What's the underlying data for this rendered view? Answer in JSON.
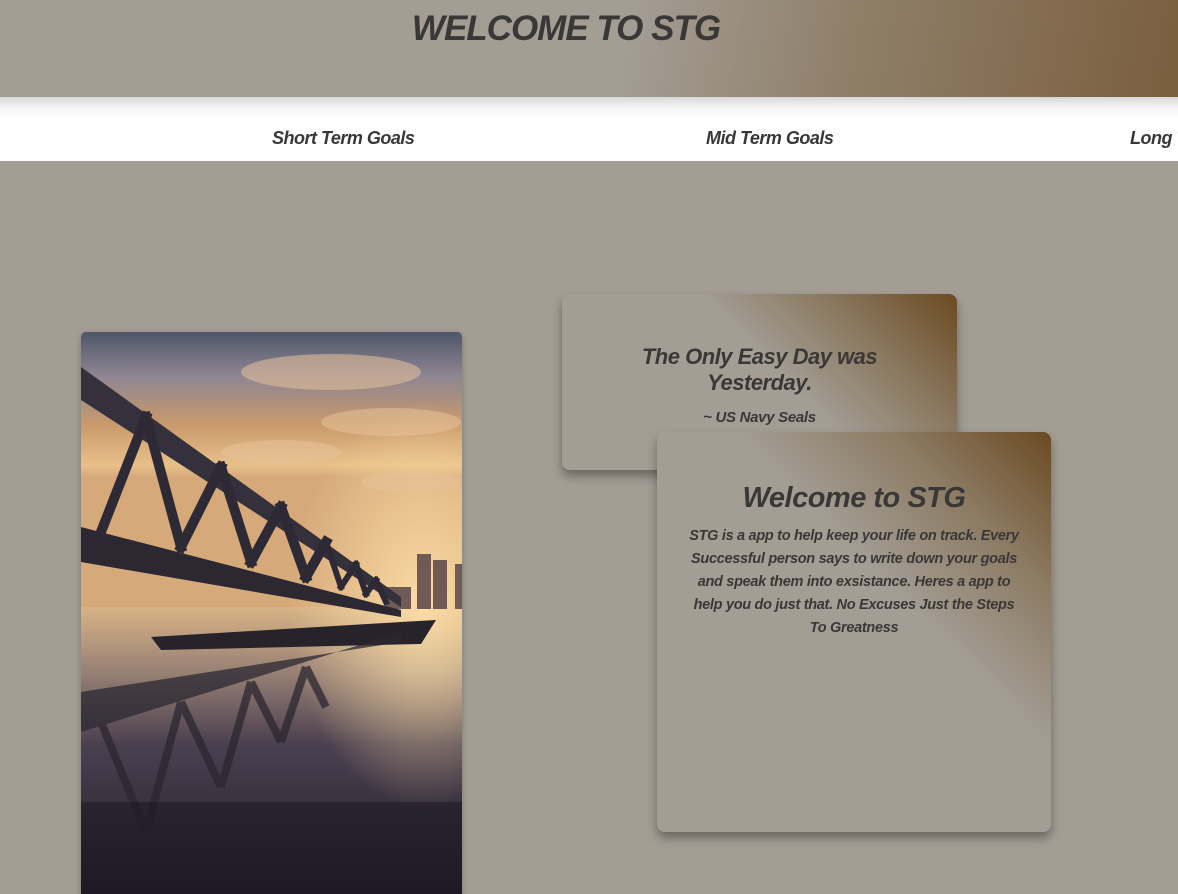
{
  "header": {
    "title": "WELCOME TO STG"
  },
  "nav": {
    "items": [
      {
        "label": "Short Term Goals"
      },
      {
        "label": "Mid Term Goals"
      },
      {
        "label": "Long T"
      }
    ]
  },
  "quote_card": {
    "quote": "The Only Easy Day was Yesterday.",
    "author": "~ US Navy Seals"
  },
  "welcome_card": {
    "title": "Welcome to STG",
    "body": "STG is a app to help keep your life on track. Every Successful person says to write down your goals and speak them into exsistance. Heres a app to help you do just that. No Excuses Just the Steps To Greatness"
  },
  "colors": {
    "background": "#a39d94",
    "accent_brown": "#6b4a22",
    "text": "#3a3836",
    "nav_background": "#ffffff"
  },
  "photo": {
    "subject": "pier-bridge-sunset-image"
  }
}
